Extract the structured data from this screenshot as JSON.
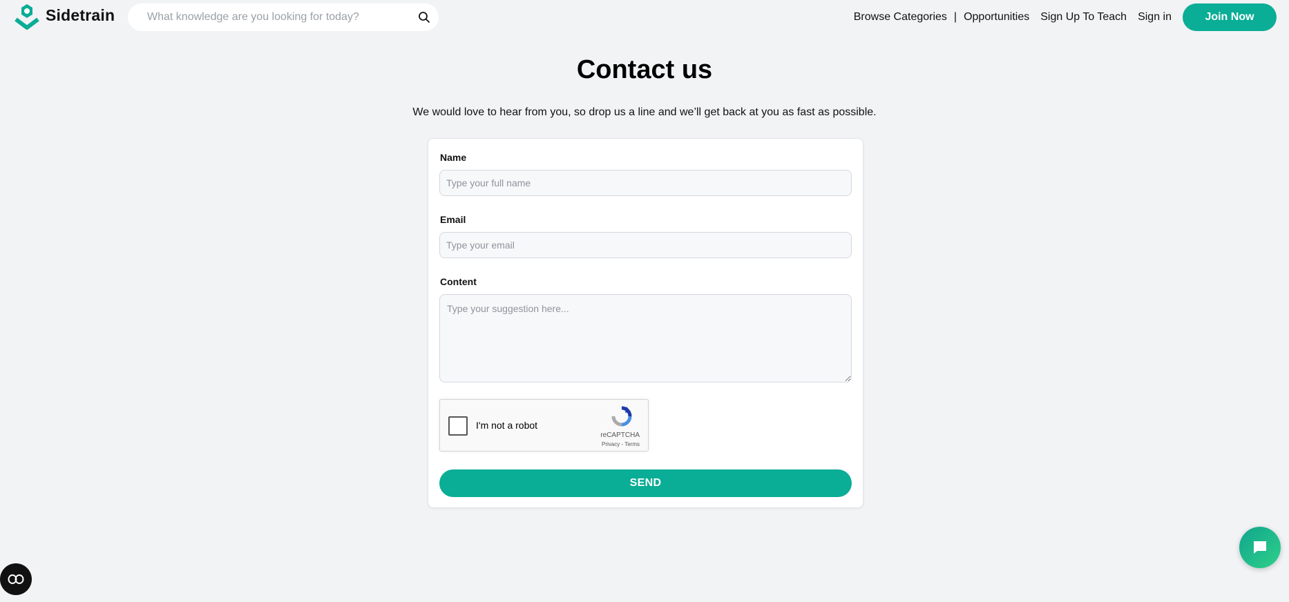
{
  "header": {
    "brand": "Sidetrain",
    "search_placeholder": "What knowledge are you looking for today?",
    "nav": {
      "browse": "Browse Categories",
      "separator": "|",
      "opportunities": "Opportunities",
      "teach": "Sign Up To Teach",
      "signin": "Sign in",
      "join": "Join Now"
    }
  },
  "main": {
    "title": "Contact us",
    "subtitle": "We would love to hear from you, so drop us a line and we’ll get back at you as fast as possible.",
    "form": {
      "name_label": "Name",
      "name_placeholder": "Type your full name",
      "email_label": "Email",
      "email_placeholder": "Type your email",
      "content_label": "Content",
      "content_placeholder": "Type your suggestion here...",
      "captcha_label": "I'm not a robot",
      "captcha_brand": "reCAPTCHA",
      "captcha_links": "Privacy - Terms",
      "send_label": "SEND"
    }
  },
  "colors": {
    "accent": "#0aad95",
    "background": "#f2f3f5"
  },
  "icons": {
    "logo": "sidetrain-logo-icon",
    "search": "search-icon",
    "chat": "chat-icon",
    "accessibility": "accessibility-icon"
  }
}
